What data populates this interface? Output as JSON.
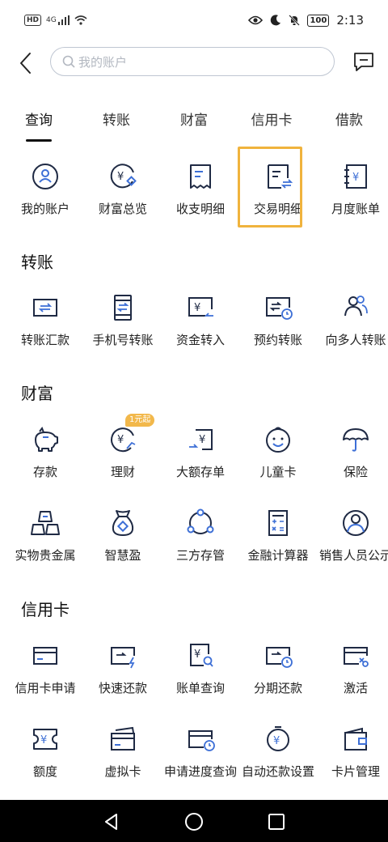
{
  "status_bar": {
    "hd": "HD",
    "network": "4G",
    "battery": "100",
    "time": "2:13"
  },
  "search": {
    "placeholder": "我的账户"
  },
  "tabs": [
    {
      "label": "查询"
    },
    {
      "label": "转账"
    },
    {
      "label": "财富"
    },
    {
      "label": "信用卡"
    },
    {
      "label": "借款"
    }
  ],
  "query_items": [
    {
      "label": "我的账户",
      "icon": "user-circle-icon"
    },
    {
      "label": "财富总览",
      "icon": "yen-coin-icon"
    },
    {
      "label": "收支明细",
      "icon": "receipt-icon"
    },
    {
      "label": "交易明细",
      "icon": "transaction-detail-icon"
    },
    {
      "label": "月度账单",
      "icon": "monthly-bill-icon"
    }
  ],
  "sections": {
    "transfer": "转账",
    "wealth": "财富",
    "credit": "信用卡"
  },
  "transfer_items": [
    {
      "label": "转账汇款",
      "icon": "transfer-card-icon"
    },
    {
      "label": "手机号转账",
      "icon": "phone-transfer-icon"
    },
    {
      "label": "资金转入",
      "icon": "fund-in-icon"
    },
    {
      "label": "预约转账",
      "icon": "scheduled-transfer-icon"
    },
    {
      "label": "向多人转账",
      "icon": "multi-person-icon"
    }
  ],
  "wealth_items_row1": [
    {
      "label": "存款",
      "icon": "piggy-bank-icon"
    },
    {
      "label": "理财",
      "icon": "wealth-management-icon"
    },
    {
      "label": "大额存单",
      "icon": "large-deposit-icon"
    },
    {
      "label": "儿童卡",
      "icon": "child-face-icon"
    },
    {
      "label": "保险",
      "icon": "umbrella-icon"
    }
  ],
  "wealth_badge": "1元起",
  "wealth_items_row2": [
    {
      "label": "实物贵金属",
      "icon": "gold-bars-icon"
    },
    {
      "label": "智慧盈",
      "icon": "money-bag-icon"
    },
    {
      "label": "三方存管",
      "icon": "triangle-nodes-icon"
    },
    {
      "label": "金融计算器",
      "icon": "calculator-icon"
    },
    {
      "label": "销售人员公示",
      "icon": "salesperson-icon"
    }
  ],
  "credit_items_row1": [
    {
      "label": "信用卡申请",
      "icon": "credit-card-icon"
    },
    {
      "label": "快速还款",
      "icon": "fast-repay-icon"
    },
    {
      "label": "账单查询",
      "icon": "bill-search-icon"
    },
    {
      "label": "分期还款",
      "icon": "installment-icon"
    },
    {
      "label": "激活",
      "icon": "activate-card-icon"
    }
  ],
  "credit_items_row2": [
    {
      "label": "额度",
      "icon": "credit-limit-icon"
    },
    {
      "label": "虚拟卡",
      "icon": "virtual-card-icon"
    },
    {
      "label": "申请进度查询",
      "icon": "application-progress-icon"
    },
    {
      "label": "自动还款设置",
      "icon": "auto-repay-icon"
    },
    {
      "label": "卡片管理",
      "icon": "wallet-icon"
    }
  ],
  "colors": {
    "accent": "#3d6fd6",
    "icon_dark": "#1f2a44",
    "highlight": "#f0b33d",
    "badge": "#f2b84b"
  }
}
